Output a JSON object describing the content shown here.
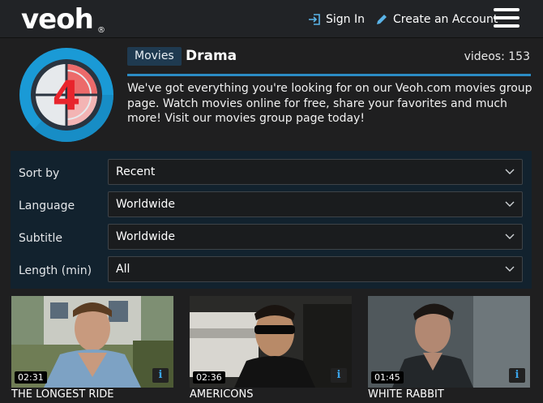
{
  "header": {
    "logo_text": "veoh",
    "logo_mark": "®",
    "signin_label": "Sign In",
    "create_label": "Create an Account"
  },
  "group": {
    "tag": "Movies",
    "title": "Drama",
    "videos_label": "videos: 153",
    "description": "We've got everything you're looking for on our Veoh.com movies group page. Watch movies online for free, share your favorites and much more! Visit our movies group page today!"
  },
  "filters": [
    {
      "label": "Sort by",
      "value": "Recent"
    },
    {
      "label": "Language",
      "value": "Worldwide"
    },
    {
      "label": "Subtitle",
      "value": "Worldwide"
    },
    {
      "label": "Length (min)",
      "value": "All"
    }
  ],
  "videos": [
    {
      "title": "THE LONGEST RIDE",
      "duration": "02:31"
    },
    {
      "title": "AMERICONS",
      "duration": "02:36"
    },
    {
      "title": "WHITE RABBIT",
      "duration": "01:45"
    }
  ],
  "colors": {
    "accent": "#2b8cc4",
    "tag_bg": "#1f3a50",
    "filter_bg": "#12222e"
  }
}
